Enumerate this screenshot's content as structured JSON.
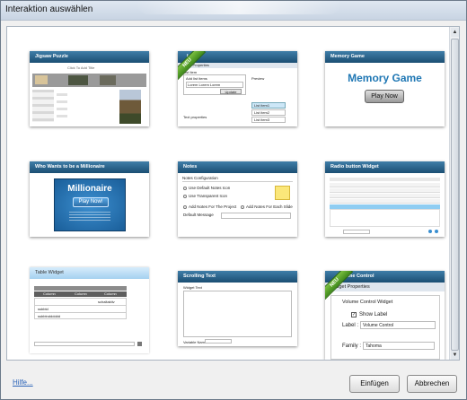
{
  "window": {
    "title": "Interaktion auswählen"
  },
  "ribbon_label": "NEU",
  "cards": {
    "jigsaw": {
      "title": "Jigsaw Puzzle",
      "subtitle": "Click To Add Title"
    },
    "list": {
      "title": "List",
      "panel_title": "Widget Properties",
      "section": "List Item",
      "add_label": "Add list items",
      "input_value": "Lorem Lorem Lorem",
      "update_button": "Update",
      "preview_label": "Preview",
      "items": [
        "List item1",
        "List item2",
        "List item3"
      ],
      "text_properties": "Text properties"
    },
    "memory": {
      "title": "Memory Game",
      "heading": "Memory Game",
      "button": "Play Now"
    },
    "millionaire": {
      "title": "Who Wants to be a Millionaire",
      "heading": "Millionaire",
      "button": "Play Now!"
    },
    "notes": {
      "title": "Notes",
      "config": "Notes Configuration",
      "opt1": "Use Default Notes Icon",
      "opt2": "Use Transparent Icon",
      "opt3": "Add Notes For The Project",
      "opt4": "Add Notes For Each Slide",
      "default_message": "Default Message"
    },
    "radio": {
      "title": "Radio button Widget"
    },
    "table": {
      "title": "Table Widget",
      "col": "Column",
      "cells": [
        "",
        "schaltaktiv",
        "",
        "",
        "ssbbtd",
        "",
        "ssbbtndddddd",
        "",
        ""
      ]
    },
    "scrolling": {
      "title": "Scrolling Text",
      "label": "Widget Text",
      "footer_label": "Variable Name"
    },
    "volume": {
      "title": "Volume Control",
      "panel_title": "Widget Properties",
      "section": "Volume Control Widget",
      "show_label": "Show Label",
      "label_caption": "Label :",
      "label_value": "Volume Control",
      "family_caption": "Family :",
      "family_value": "Tahoma"
    }
  },
  "footer": {
    "help": "Hilfe...",
    "insert": "Einfügen",
    "cancel": "Abbrechen"
  }
}
